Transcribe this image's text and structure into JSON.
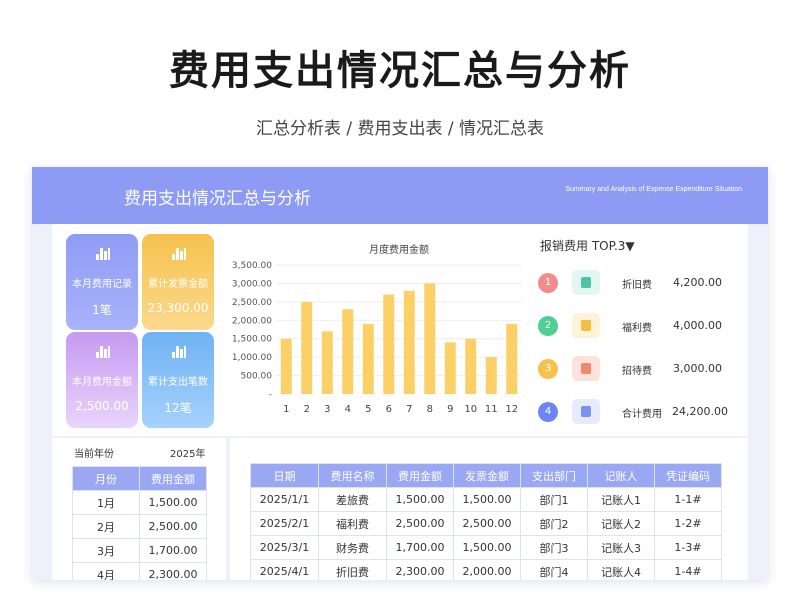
{
  "page": {
    "title": "费用支出情况汇总与分析",
    "subtitle": "汇总分析表  /  费用支出表 / 情况汇总表"
  },
  "banner": {
    "title": "费用支出情况汇总与分析",
    "subtitle_en": "Summary and Analysis of Expense Expenditure Situation"
  },
  "cards": [
    {
      "label": "本月费用记录",
      "value": "1笔",
      "icon": "bar-chart-icon",
      "color": "#8f9cf4"
    },
    {
      "label": "累计发票金额",
      "value": "23,300.00",
      "icon": "bar-chart-icon",
      "color": "#f6c24d"
    },
    {
      "label": "本月费用金额",
      "value": "2,500.00",
      "icon": "bar-chart-icon",
      "color": "#c59af1"
    },
    {
      "label": "累计支出笔数",
      "value": "12笔",
      "icon": "bar-chart-icon",
      "color": "#6fb2f4"
    }
  ],
  "chart_data": {
    "type": "bar",
    "title": "月度费用金额",
    "categories": [
      "1",
      "2",
      "3",
      "4",
      "5",
      "6",
      "7",
      "8",
      "9",
      "10",
      "11",
      "12"
    ],
    "values": [
      1500,
      2500,
      1700,
      2300,
      1900,
      2700,
      2800,
      3000,
      1400,
      1500,
      1000,
      1900
    ],
    "ylim": [
      0,
      3500
    ],
    "yticks": [
      "-",
      "500.00",
      "1,000.00",
      "1,500.00",
      "2,000.00",
      "2,500.00",
      "3,000.00",
      "3,500.00"
    ],
    "bar_color": "#fbd167",
    "grid": true
  },
  "top3": {
    "title": "报销费用 TOP.3▼",
    "items": [
      {
        "rank": "1",
        "name": "折旧费",
        "value": "4,200.00",
        "badge_color": "#f28b8b",
        "icon_bg": "#e3f6f1",
        "icon_color": "#4cc5a6"
      },
      {
        "rank": "2",
        "name": "福利费",
        "value": "4,000.00",
        "badge_color": "#4fcf93",
        "icon_bg": "#fdf3d8",
        "icon_color": "#f4bf3e"
      },
      {
        "rank": "3",
        "name": "招待费",
        "value": "3,000.00",
        "badge_color": "#f6c24d",
        "icon_bg": "#fde3dc",
        "icon_color": "#f08a6a"
      },
      {
        "rank": "4",
        "name": "合计费用",
        "value": "24,200.00",
        "badge_color": "#6c86f2",
        "icon_bg": "#e6ebfd",
        "icon_color": "#7c90f3"
      }
    ]
  },
  "summary": {
    "year_label": "当前年份",
    "year_value": "2025年",
    "headers": [
      "月份",
      "费用金额"
    ],
    "rows": [
      [
        "1月",
        "1,500.00"
      ],
      [
        "2月",
        "2,500.00"
      ],
      [
        "3月",
        "1,700.00"
      ],
      [
        "4月",
        "2,300.00"
      ]
    ]
  },
  "detail": {
    "headers": [
      "日期",
      "费用名称",
      "费用金额",
      "发票金额",
      "支出部门",
      "记账人",
      "凭证编码"
    ],
    "rows": [
      [
        "2025/1/1",
        "差旅费",
        "1,500.00",
        "1,500.00",
        "部门1",
        "记账人1",
        "1-1#"
      ],
      [
        "2025/2/1",
        "福利费",
        "2,500.00",
        "2,500.00",
        "部门2",
        "记账人2",
        "1-2#"
      ],
      [
        "2025/3/1",
        "财务费",
        "1,700.00",
        "1,500.00",
        "部门3",
        "记账人3",
        "1-3#"
      ],
      [
        "2025/4/1",
        "折旧费",
        "2,300.00",
        "2,000.00",
        "部门4",
        "记账人4",
        "1-4#"
      ]
    ]
  }
}
